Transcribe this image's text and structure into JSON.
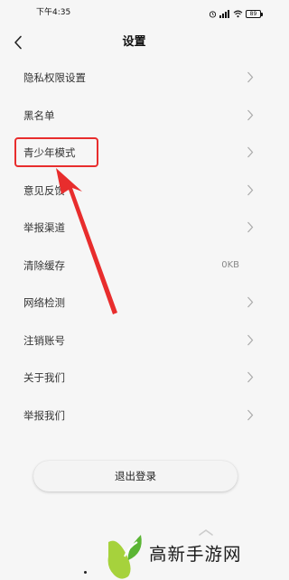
{
  "status_bar": {
    "time": "下午4:35",
    "battery": "89",
    "icons": [
      "alarm-icon",
      "signal-icon",
      "wifi-icon",
      "battery-icon"
    ]
  },
  "header": {
    "title": "设置",
    "back_icon": "chevron-left-icon"
  },
  "settings": {
    "items": [
      {
        "label": "隐私权限设置",
        "value": ""
      },
      {
        "label": "黑名单",
        "value": ""
      },
      {
        "label": "青少年模式",
        "value": ""
      },
      {
        "label": "意见反馈",
        "value": ""
      },
      {
        "label": "举报渠道",
        "value": ""
      },
      {
        "label": "清除缓存",
        "value": "0KB"
      },
      {
        "label": "网络检测",
        "value": ""
      },
      {
        "label": "注销账号",
        "value": ""
      },
      {
        "label": "关于我们",
        "value": ""
      },
      {
        "label": "举报我们",
        "value": ""
      }
    ]
  },
  "logout_label": "退出登录",
  "annotation": {
    "highlight_color": "#e82d2d"
  },
  "watermark": {
    "text": "高新手游网"
  }
}
